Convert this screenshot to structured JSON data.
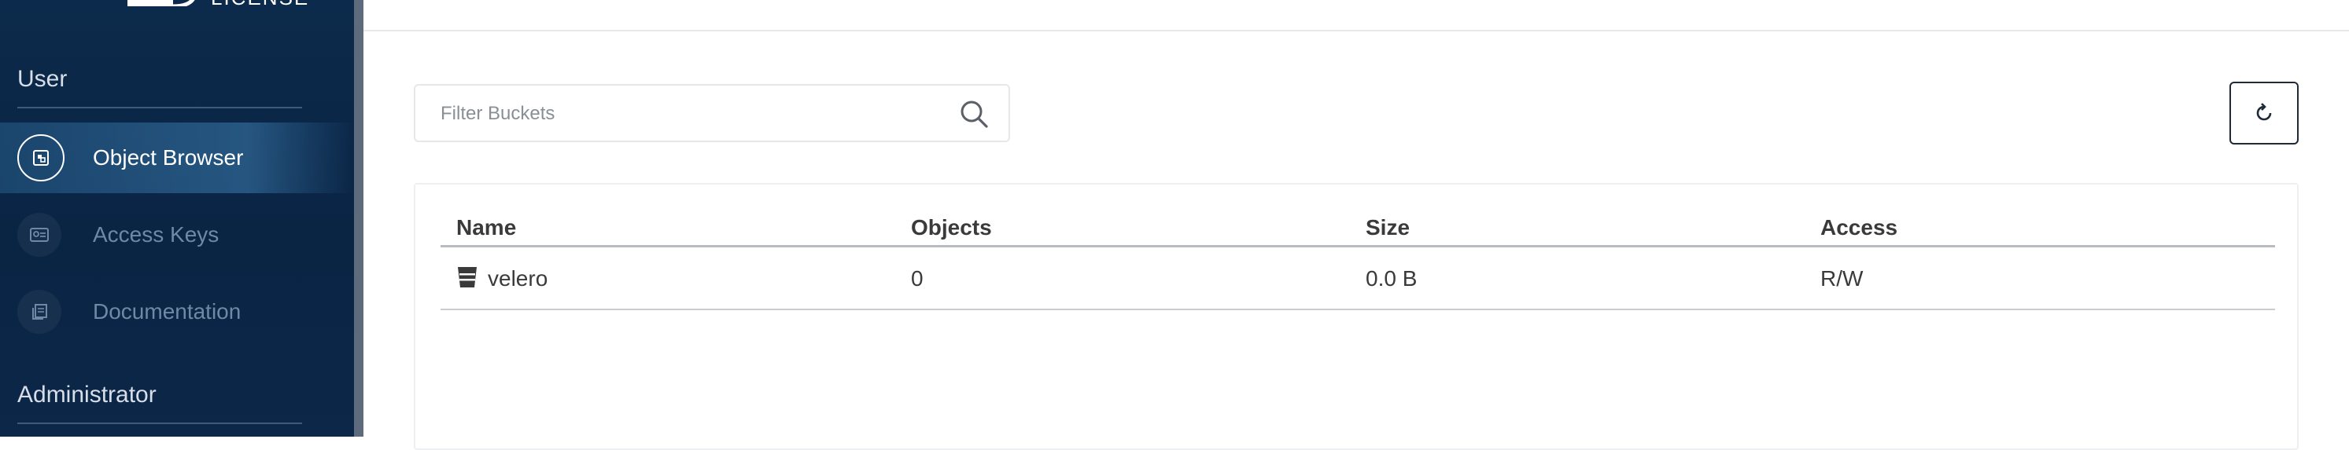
{
  "sidebar": {
    "logo_text": "LICENSE",
    "sections": [
      {
        "title": "User",
        "items": [
          {
            "label": "Object Browser",
            "icon": "object-browser-icon",
            "active": true
          },
          {
            "label": "Access Keys",
            "icon": "access-keys-icon",
            "active": false
          },
          {
            "label": "Documentation",
            "icon": "documentation-icon",
            "active": false
          }
        ]
      },
      {
        "title": "Administrator",
        "items": []
      }
    ]
  },
  "search": {
    "placeholder": "Filter Buckets",
    "value": ""
  },
  "table": {
    "headers": [
      "Name",
      "Objects",
      "Size",
      "Access"
    ],
    "rows": [
      {
        "name": "velero",
        "objects": "0",
        "size": "0.0 B",
        "access": "R/W"
      }
    ]
  },
  "colors": {
    "sidebar_bg": "#0c2a4b",
    "active_item": "#2f6a9a",
    "text_dark": "#3a3a3a"
  }
}
